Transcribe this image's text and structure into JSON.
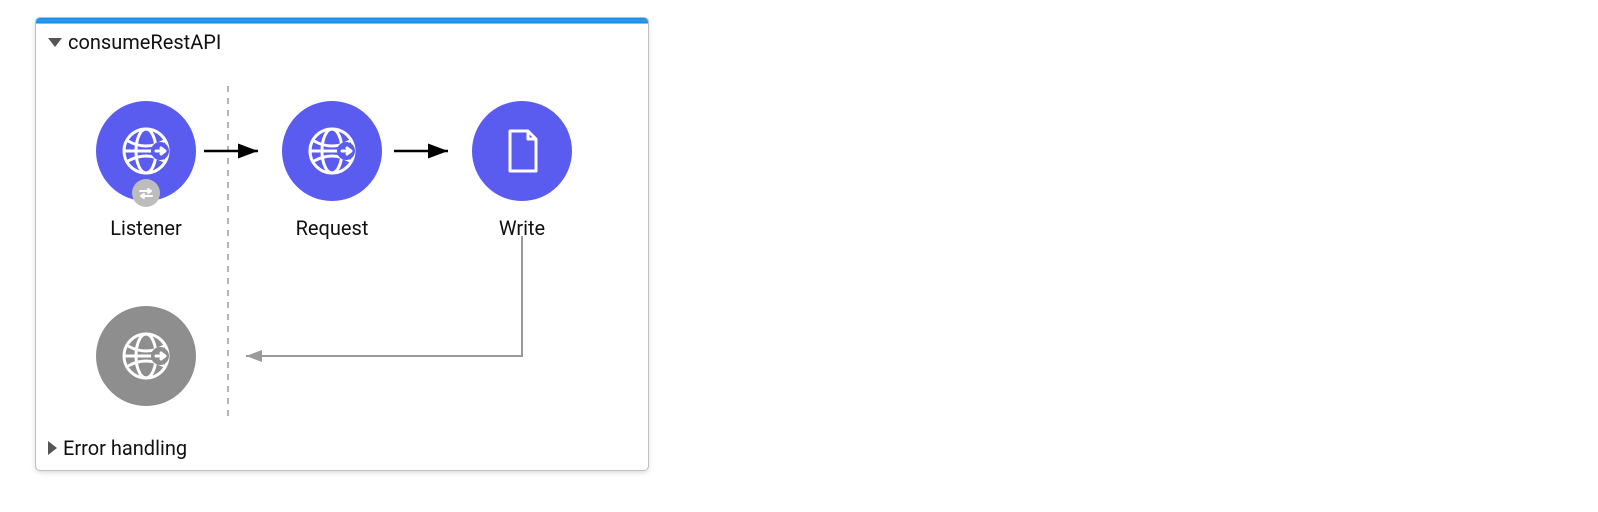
{
  "flow": {
    "title": "consumeRestAPI",
    "expanded": true,
    "nodes": {
      "listener": {
        "label": "Listener"
      },
      "request": {
        "label": "Request"
      },
      "write": {
        "label": "Write"
      }
    },
    "errorSection": {
      "label": "Error handling",
      "expanded": false
    }
  }
}
